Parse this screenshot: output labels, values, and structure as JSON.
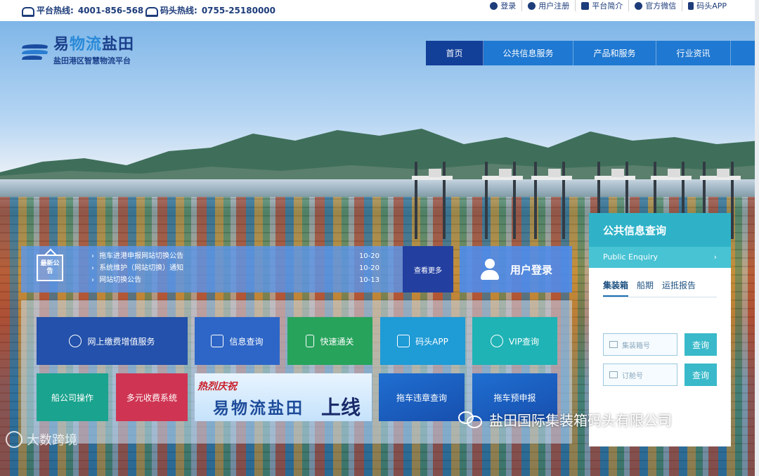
{
  "topbar": {
    "hotline_label": "平台热线:",
    "hotline_number": "4001-856-568",
    "terminal_label": "码头热线:",
    "terminal_number": "0755-25180000",
    "links": [
      "登录",
      "用户注册",
      "平台简介",
      "官方微信",
      "码头APP"
    ]
  },
  "logo": {
    "title_a": "易",
    "title_b": "物流",
    "title_c": "盐田",
    "subtitle": "盐田港区智慧物流平台"
  },
  "nav": {
    "items": [
      "首页",
      "公共信息服务",
      "产品和服务",
      "行业资讯"
    ]
  },
  "notice": {
    "badge": "最新公告",
    "items": [
      {
        "title": "拖车进港申报网站切换公告",
        "date": "10-20"
      },
      {
        "title": "系统维护（网站切换）通知",
        "date": "10-20"
      },
      {
        "title": "网站切换公告",
        "date": "10-13"
      }
    ],
    "more": "查看更多"
  },
  "login": {
    "label": "用户登录"
  },
  "services": {
    "row1": [
      "网上缴费增值服务",
      "信息查询",
      "快速通关",
      "码头APP",
      "VIP查询"
    ],
    "row2": [
      "船公司操作",
      "多元收费系统",
      "拖车违章查询",
      "拖车预申报"
    ],
    "promo": {
      "line1": "热烈庆祝",
      "line2": "易物流盐田",
      "line3": "上线"
    }
  },
  "enquiry": {
    "title": "公共信息查询",
    "subtitle": "Public Enquiry",
    "arrow": "›",
    "tabs": [
      "集装箱",
      "船期",
      "运抵报告"
    ],
    "container_placeholder": "集装箱号",
    "booking_placeholder": "订舱号",
    "query_button": "查询"
  },
  "watermarks": {
    "company": "盐田国际集装箱码头有限公司",
    "brand": "大数跨境"
  },
  "colors": {
    "nav_active": "#123f98",
    "nav_bg": "#1f78d1",
    "enquiry_header": "#2fb2c8"
  }
}
